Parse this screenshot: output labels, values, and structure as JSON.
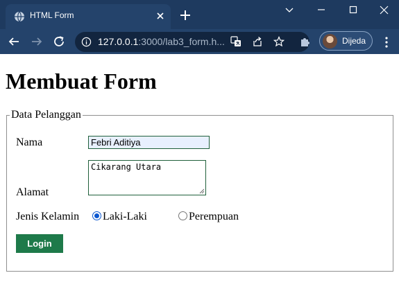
{
  "browser": {
    "tab_title": "HTML Form",
    "url_host": "127.0.0.1",
    "url_rest": ":3000/lab3_form.h...",
    "profile_name": "Dijeda"
  },
  "icons": [
    "globe-icon",
    "close-icon",
    "plus-icon",
    "chevron-down-icon",
    "minimize-icon",
    "maximize-icon",
    "window-close-icon",
    "back-arrow-icon",
    "forward-arrow-icon",
    "reload-icon",
    "info-icon",
    "translate-icon",
    "share-icon",
    "star-icon",
    "puzzle-icon",
    "kebab-menu-icon"
  ],
  "colors": {
    "chrome_dark": "#1e3a5f",
    "chrome_toolbar": "#24436b",
    "login_button": "#1e7a4a",
    "radio_accent": "#0b57d0"
  },
  "page": {
    "title": "Membuat Form",
    "legend": "Data Pelanggan",
    "nama_label": "Nama",
    "nama_value": "Febri Aditiya",
    "alamat_label": "Alamat",
    "alamat_value": "Cikarang Utara",
    "jenis_kelamin_label": "Jenis Kelamin",
    "gender_options": [
      {
        "label": "Laki-Laki",
        "checked": true
      },
      {
        "label": "Perempuan",
        "checked": false
      }
    ],
    "login_label": "Login"
  }
}
